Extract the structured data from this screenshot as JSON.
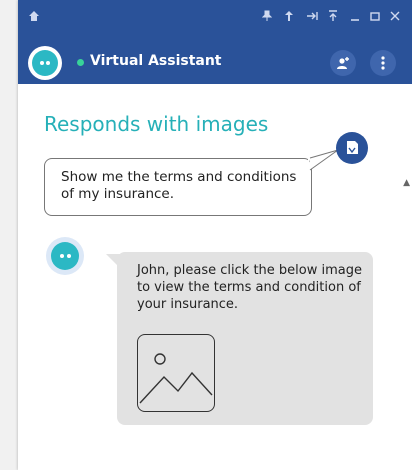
{
  "titlebar": {
    "icons": [
      "pin-icon",
      "upload-icon",
      "arrow-icon",
      "arrow-up-icon",
      "minimize-icon",
      "maximize-icon",
      "close-icon"
    ]
  },
  "header": {
    "title": "Virtual Assistant",
    "status_color": "#38d399",
    "brand_color": "#2a5299"
  },
  "chat": {
    "section_title": "Responds with images",
    "user_message": "Show me the terms and conditions of my insurance.",
    "bot_message": "John, please click the below image to view the terms and condition of your insurance."
  },
  "colors": {
    "accent": "#26b0b8",
    "bot_bubble": "#e2e2e2"
  }
}
